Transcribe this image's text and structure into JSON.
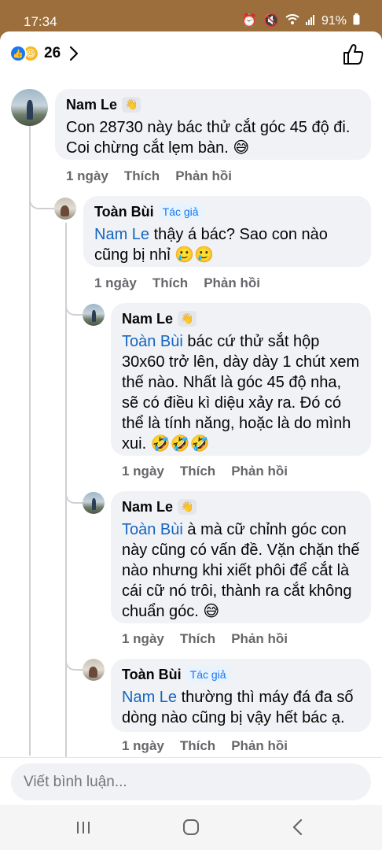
{
  "status_bar": {
    "time": "17:34",
    "battery": "91%",
    "icons": [
      "alarm-icon",
      "mute-icon",
      "wifi-icon",
      "signal-icon",
      "battery-icon"
    ]
  },
  "reactions": {
    "types": [
      "like",
      "haha"
    ],
    "count": "26"
  },
  "comments": [
    {
      "author": "Nam Le",
      "author_badge": "",
      "mention": "",
      "text": "Con 28730 này bác thử cắt góc 45 độ đi. Coi chừng cắt lẹm bàn. 😅",
      "time": "1 ngày",
      "like_label": "Thích",
      "reply_label": "Phản hồi"
    },
    {
      "author": "Toàn Bùi",
      "author_badge": "Tác giả",
      "mention": "Nam Le",
      "text": " thậy á bác? Sao con nào cũng bị nhỉ 🥲🥲",
      "time": "1 ngày",
      "like_label": "Thích",
      "reply_label": "Phản hồi"
    },
    {
      "author": "Nam Le",
      "author_badge": "",
      "mention": "Toàn Bùi",
      "text": " bác cứ thử sắt hộp 30x60 trở lên, dày dày 1 chút xem thế nào. Nhất là góc 45 độ nha, sẽ có điều kì diệu xảy ra. Đó có thể là tính năng, hoặc là do mình xui. 🤣🤣🤣",
      "time": "1 ngày",
      "like_label": "Thích",
      "reply_label": "Phản hồi"
    },
    {
      "author": "Nam Le",
      "author_badge": "",
      "mention": "Toàn Bùi",
      "text": " à mà cữ chỉnh góc con này cũng có vấn đề. Vặn chặn thế nào nhưng khi xiết phôi để cắt là cái cữ nó trôi, thành ra cắt không chuẩn góc. 😅",
      "time": "1 ngày",
      "like_label": "Thích",
      "reply_label": "Phản hồi"
    },
    {
      "author": "Toàn Bùi",
      "author_badge": "Tác giả",
      "mention": "Nam Le",
      "text": " thường thì máy đá đa số dòng nào cũng bị vậy hết bác ạ.",
      "time": "1 ngày",
      "like_label": "Thích",
      "reply_label": "Phản hồi"
    }
  ],
  "compose": {
    "placeholder": "Viết bình luận..."
  },
  "nav_bar": {
    "buttons": [
      "recent-apps-icon",
      "home-icon",
      "back-icon"
    ]
  }
}
